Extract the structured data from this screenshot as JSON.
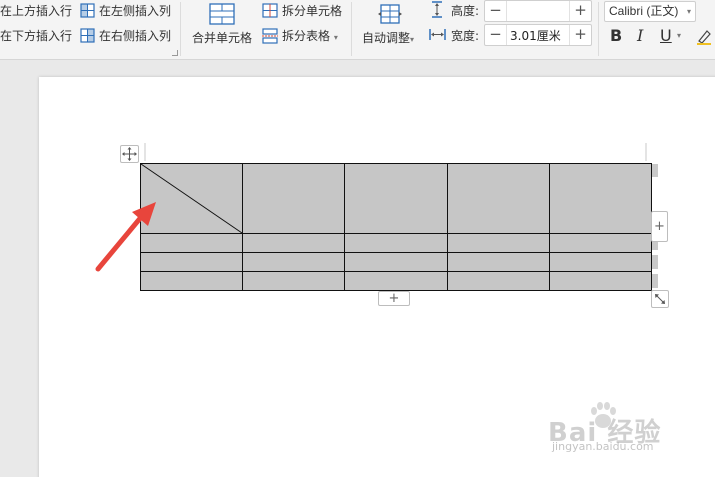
{
  "ribbon": {
    "insert_row_above": "在上方插入行",
    "insert_row_below": "在下方插入行",
    "insert_col_left": "在左侧插入列",
    "insert_col_right": "在右侧插入列",
    "merge_cells": "合并单元格",
    "split_cells": "拆分单元格",
    "split_table": "拆分表格",
    "split_table_caret": "▾",
    "auto_fit": "自动调整",
    "auto_fit_caret": "▾",
    "height_label": "高度:",
    "height_value": "",
    "width_label": "宽度:",
    "width_value": "3.01厘米",
    "stepper_minus": "−",
    "stepper_plus": "+",
    "font_name": "Calibri (正文)",
    "font_caret": "▾",
    "bold": "B",
    "italic": "I",
    "underline": "U",
    "underline_caret": "▾"
  },
  "table": {
    "add_row_button": "+",
    "add_col_button": "+"
  },
  "watermark": {
    "brand": "Bai 经验",
    "url": "jingyan.baidu.com"
  },
  "colors": {
    "cell_shading": "#c6c6c6",
    "arrow": "#e8453c",
    "icon_blue": "#2f6fb8"
  }
}
